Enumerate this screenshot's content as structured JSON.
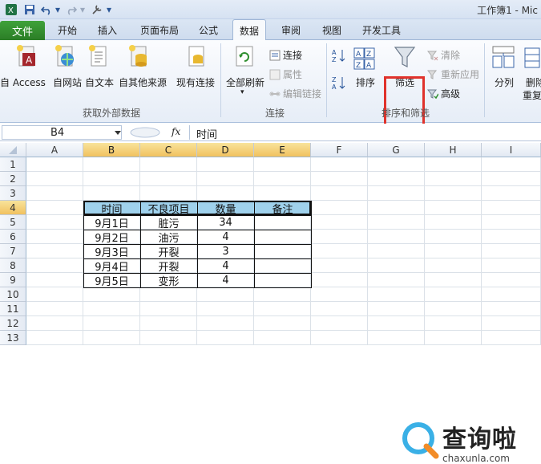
{
  "window": {
    "title": "工作簿1 - Mic"
  },
  "quick_access": {
    "menu_glyph": "▾"
  },
  "tabs": {
    "file": "文件",
    "items": [
      "开始",
      "插入",
      "页面布局",
      "公式",
      "数据",
      "审阅",
      "视图",
      "开发工具"
    ]
  },
  "ribbon": {
    "get_external": {
      "access": "自 Access",
      "web": "自网站",
      "text": "自文本",
      "other": "自其他来源",
      "existing": "现有连接",
      "label": "获取外部数据"
    },
    "connections": {
      "refresh_all": "全部刷新",
      "connections": "连接",
      "properties": "属性",
      "edit_links": "编辑链接",
      "label": "连接"
    },
    "sort_filter": {
      "sort": "排序",
      "filter": "筛选",
      "clear": "清除",
      "reapply": "重新应用",
      "advanced": "高级",
      "label": "排序和筛选"
    },
    "data_tools": {
      "text_to_columns": "分列",
      "remove": "删除",
      "remove_dup": "重复"
    }
  },
  "formula_bar": {
    "name_box": "B4",
    "fx": "fx",
    "value": "时间"
  },
  "columns": [
    "A",
    "B",
    "C",
    "D",
    "E",
    "F",
    "G",
    "H",
    "I"
  ],
  "rows": [
    "1",
    "2",
    "3",
    "4",
    "5",
    "6",
    "7",
    "8",
    "9",
    "10",
    "11",
    "12",
    "13"
  ],
  "table": {
    "headers": [
      "时间",
      "不良项目",
      "数量",
      "备注"
    ],
    "rows": [
      [
        "9月1日",
        "脏污",
        "34",
        ""
      ],
      [
        "9月2日",
        "油污",
        "4",
        ""
      ],
      [
        "9月3日",
        "开裂",
        "3",
        ""
      ],
      [
        "9月4日",
        "开裂",
        "4",
        ""
      ],
      [
        "9月5日",
        "变形",
        "4",
        ""
      ]
    ]
  },
  "watermark": {
    "brand": "查询啦",
    "domain": "chaxunla.com"
  },
  "colors": {
    "accent_green": "#2b7d26",
    "highlight_red": "#e0322b",
    "header_fill": "#9fd1ec",
    "selected_header": "#f1c15f"
  }
}
